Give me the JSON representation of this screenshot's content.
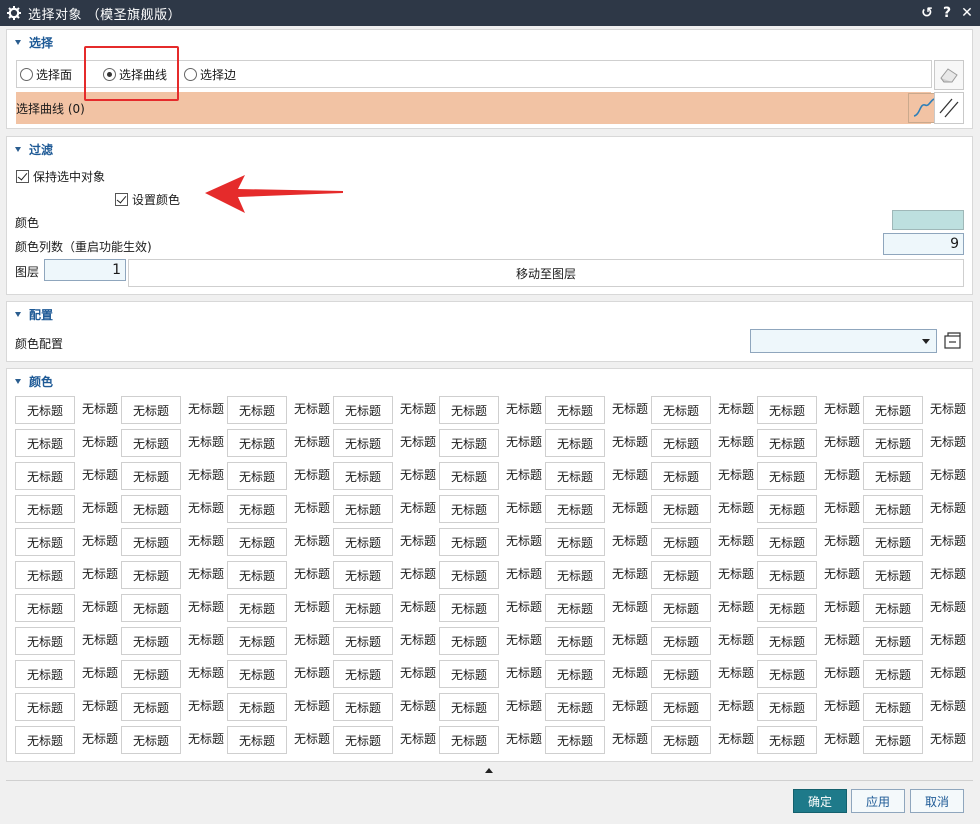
{
  "window": {
    "title": "选择对象 （模圣旗舰版）",
    "reset_glyph": "↺",
    "help_glyph": "?",
    "close_glyph": "✕"
  },
  "selection": {
    "header": "选择",
    "options": [
      "选择面",
      "选择曲线",
      "选择边"
    ],
    "selected": "选择曲线",
    "curve_label": "选择曲线 (0)"
  },
  "filter": {
    "header": "过滤",
    "keep_selected": "保持选中对象",
    "set_color": "设置颜色",
    "color_label": "颜色",
    "color_value": "#bde0df",
    "color_columns_label": "颜色列数（重启功能生效)",
    "color_columns_value": "9",
    "layer_label": "图层",
    "layer_value": "1",
    "move_to_layer": "移动至图层"
  },
  "config": {
    "header": "配置",
    "color_config_label": "颜色配置",
    "color_config_value": ""
  },
  "colors": {
    "header": "颜色",
    "cell_label": "无标题",
    "rows": 11,
    "pairs_per_row": 9
  },
  "footer": {
    "ok": "确定",
    "apply": "应用",
    "cancel": "取消"
  },
  "accent_colors": {
    "titlebar": "#2e3847",
    "selected_row": "#f2c3a4",
    "highlight": "#e52b2b",
    "primary_button": "#1e7a8a"
  }
}
